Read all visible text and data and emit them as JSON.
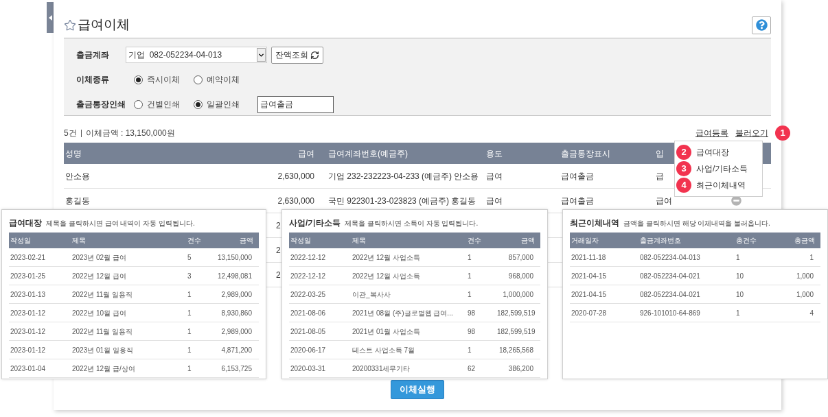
{
  "title": "급여이체",
  "form": {
    "account": {
      "label": "출금계좌",
      "value": "기업  082-052234-04-013",
      "button": "잔액조회"
    },
    "transfer_type": {
      "label": "이체종류",
      "options": [
        {
          "label": "즉시이체",
          "selected": true
        },
        {
          "label": "예약이체",
          "selected": false
        }
      ]
    },
    "passbook_print": {
      "label": "출금통장인쇄",
      "options": [
        {
          "label": "건별인쇄",
          "selected": false
        },
        {
          "label": "일괄인쇄",
          "selected": true
        }
      ],
      "memo": "급여출금"
    }
  },
  "summary": {
    "count": "5건",
    "total": "이체금액 : 13,150,000원"
  },
  "links": [
    {
      "label": "급여등록"
    },
    {
      "label": "불러오기",
      "badge": "1"
    }
  ],
  "table": {
    "columns": [
      "성명",
      "급여",
      "급여계좌번호(예금주)",
      "용도",
      "출금통장표시",
      "입"
    ],
    "rows": [
      {
        "kind": "full",
        "cells": [
          "안소용",
          "2,630,000",
          "기업 232-232223-04-233 (예금주) 안소용",
          "급여",
          "급여출금",
          "급"
        ],
        "removable": false
      },
      {
        "kind": "full",
        "cells": [
          "홍길동",
          "2,630,000",
          "국민 922301-23-023823 (예금주) 홍길동",
          "급여",
          "급여출금",
          "급여"
        ],
        "removable": true
      },
      {
        "kind": "partial",
        "cells": [
          "2"
        ]
      },
      {
        "kind": "partial",
        "cells": [
          "2"
        ]
      },
      {
        "kind": "partial",
        "cells": [
          "2"
        ]
      }
    ]
  },
  "menu": [
    {
      "badge": "2",
      "label": "급여대장"
    },
    {
      "badge": "3",
      "label": "사업/기타소득"
    },
    {
      "badge": "4",
      "label": "최근이체내역"
    }
  ],
  "popups": [
    {
      "title": "급여대장",
      "hint": "제목을 클릭하시면 급여 내역이 자동 입력됩니다.",
      "columns": [
        "작성일",
        "제목",
        "건수",
        "금액"
      ],
      "rows": [
        [
          "2023-02-21",
          "2023년 02월 급여",
          "5",
          "13,150,000"
        ],
        [
          "2023-01-25",
          "2022년 12월 급여",
          "3",
          "12,498,081"
        ],
        [
          "2023-01-13",
          "2022년 11월 일용직",
          "1",
          "2,989,000"
        ],
        [
          "2023-01-12",
          "2022년 10월 급여",
          "1",
          "8,930,860"
        ],
        [
          "2023-01-12",
          "2022년 11월 일용직",
          "1",
          "2,989,000"
        ],
        [
          "2023-01-12",
          "2023년 01월 일용직",
          "1",
          "4,871,200"
        ],
        [
          "2023-01-04",
          "2022년 12월 급/상여",
          "1",
          "6,153,725"
        ]
      ]
    },
    {
      "title": "사업/기타소득",
      "hint": "제목을 클릭하시면 소득이 자동 입력됩니다.",
      "columns": [
        "작성일",
        "제목",
        "건수",
        "금액"
      ],
      "rows": [
        [
          "2022-12-12",
          "2022년 12월 사업소득",
          "1",
          "857,000"
        ],
        [
          "2022-12-12",
          "2022년 12월 사업소득",
          "1",
          "968,000"
        ],
        [
          "2022-03-25",
          "이관_복사사",
          "1",
          "1,000,000"
        ],
        [
          "2021-08-06",
          "2021년 08월 (주)글로벌웹 급여...",
          "98",
          "182,599,519"
        ],
        [
          "2021-08-05",
          "2021년 01월 사업소득",
          "98",
          "182,599,519"
        ],
        [
          "2020-06-17",
          "테스트 사업소득 7월",
          "1",
          "18,265,568"
        ],
        [
          "2020-03-31",
          "20200331세무기타",
          "62",
          "386,200"
        ]
      ]
    },
    {
      "title": "최근이체내역",
      "hint": "금액을 클릭하시면 해당 이체내역을 불러옵니다.",
      "columns": [
        "거래일자",
        "출금계좌번호",
        "총건수",
        "총금액"
      ],
      "rows": [
        [
          "2021-11-18",
          "082-052234-04-013",
          "1",
          "1"
        ],
        [
          "2021-04-15",
          "082-052234-04-021",
          "10",
          "1,000"
        ],
        [
          "2021-04-15",
          "082-052234-04-021",
          "10",
          "1,000"
        ],
        [
          "2020-07-28",
          "926-101010-64-869",
          "1",
          "4"
        ]
      ]
    }
  ],
  "execute_button": "이체실행"
}
